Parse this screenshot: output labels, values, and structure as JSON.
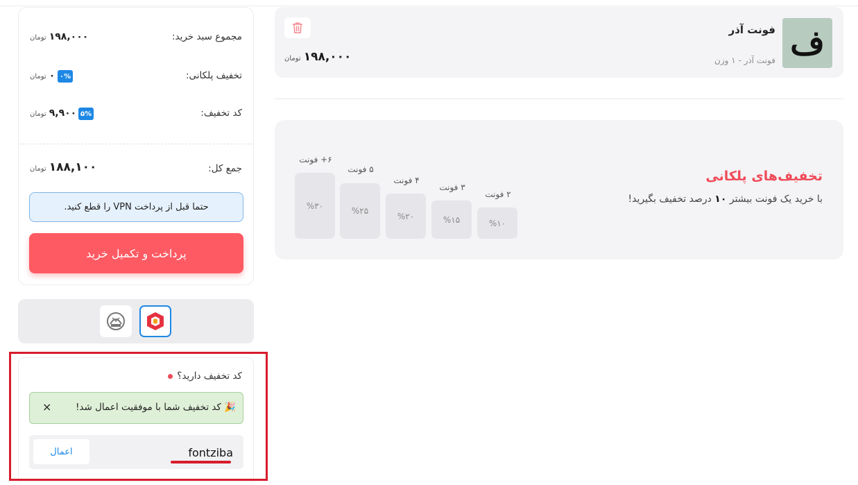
{
  "cart": {
    "item": {
      "thumb_glyph": "ف",
      "name": "فونت آذر",
      "subtitle": "فونت آذر - ۱ وزن",
      "price": "۱۹۸,۰۰۰",
      "currency": "تومان",
      "remove_icon": "trash-icon"
    }
  },
  "bulk_discounts": {
    "title": "تخفیف‌های پلکانی",
    "desc_before": "با خرید یک فونت بیشتر",
    "desc_bold": "۱۰",
    "desc_after": "درصد تخفیف بگیرید!",
    "tiers": [
      {
        "label": "۲ فونت",
        "percent": "%۱۰"
      },
      {
        "label": "۳ فونت",
        "percent": "%۱۵"
      },
      {
        "label": "۴ فونت",
        "percent": "%۲۰"
      },
      {
        "label": "۵ فونت",
        "percent": "%۲۵"
      },
      {
        "label": "۶+ فونت",
        "percent": "%۳۰"
      }
    ]
  },
  "summary": {
    "subtotal_label": "مجموع سبد خرید:",
    "subtotal_value": "۱۹۸,۰۰۰",
    "tier_discount_label": "تخفیف پلکانی:",
    "tier_discount_badge": "۰%",
    "tier_discount_value": "۰",
    "coupon_label": "کد تخفیف:",
    "coupon_badge": "۵%",
    "coupon_value": "۹,۹۰۰",
    "total_label": "جمع کل:",
    "total_value": "۱۸۸,۱۰۰",
    "currency": "تومان",
    "vpn_notice": "حتما قبل از پرداخت VPN را قطع کنید.",
    "pay_button": "پرداخت و تکمیل خرید"
  },
  "gateways": {
    "selected": "bank-mellat-icon",
    "other": "bank-logo-icon"
  },
  "coupon": {
    "question": "کد تخفیف دارید؟",
    "success_message": "کد تخفیف شما با موفقیت اعمال شد!",
    "success_icon": "🎉",
    "close": "×",
    "code_value": "fontziba",
    "apply_label": "اعمال"
  },
  "colors": {
    "accent_red": "#fd5a63",
    "accent_blue": "#1e88e5",
    "highlight_red": "#d71c2c"
  }
}
